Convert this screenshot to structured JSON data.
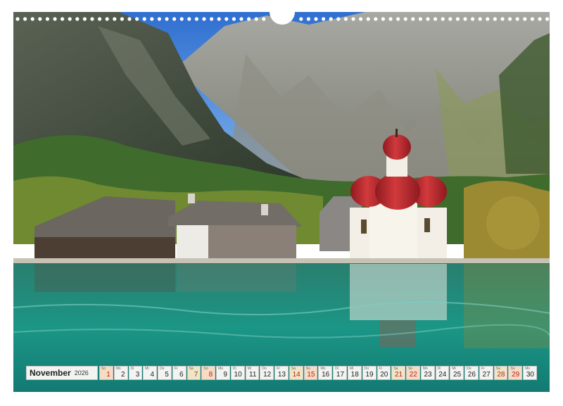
{
  "calendar": {
    "month": "November",
    "year": "2026",
    "days": [
      {
        "num": "1",
        "wd": "So",
        "type": "sun"
      },
      {
        "num": "2",
        "wd": "Mo",
        "type": "wk"
      },
      {
        "num": "3",
        "wd": "Di",
        "type": "wk"
      },
      {
        "num": "4",
        "wd": "Mi",
        "type": "wk"
      },
      {
        "num": "5",
        "wd": "Do",
        "type": "wk"
      },
      {
        "num": "6",
        "wd": "Fr",
        "type": "wk"
      },
      {
        "num": "7",
        "wd": "Sa",
        "type": "sat"
      },
      {
        "num": "8",
        "wd": "So",
        "type": "sun"
      },
      {
        "num": "9",
        "wd": "Mo",
        "type": "wk"
      },
      {
        "num": "10",
        "wd": "Di",
        "type": "wk"
      },
      {
        "num": "11",
        "wd": "Mi",
        "type": "wk"
      },
      {
        "num": "12",
        "wd": "Do",
        "type": "wk"
      },
      {
        "num": "13",
        "wd": "Fr",
        "type": "wk"
      },
      {
        "num": "14",
        "wd": "Sa",
        "type": "sat"
      },
      {
        "num": "15",
        "wd": "So",
        "type": "sun"
      },
      {
        "num": "16",
        "wd": "Mo",
        "type": "wk"
      },
      {
        "num": "17",
        "wd": "Di",
        "type": "wk"
      },
      {
        "num": "18",
        "wd": "Mi",
        "type": "wk"
      },
      {
        "num": "19",
        "wd": "Do",
        "type": "wk"
      },
      {
        "num": "20",
        "wd": "Fr",
        "type": "wk"
      },
      {
        "num": "21",
        "wd": "Sa",
        "type": "sat"
      },
      {
        "num": "22",
        "wd": "So",
        "type": "sun"
      },
      {
        "num": "23",
        "wd": "Mo",
        "type": "wk"
      },
      {
        "num": "24",
        "wd": "Di",
        "type": "wk"
      },
      {
        "num": "25",
        "wd": "Mi",
        "type": "wk"
      },
      {
        "num": "26",
        "wd": "Do",
        "type": "wk"
      },
      {
        "num": "27",
        "wd": "Fr",
        "type": "wk"
      },
      {
        "num": "28",
        "wd": "Sa",
        "type": "sat"
      },
      {
        "num": "29",
        "wd": "So",
        "type": "sun"
      },
      {
        "num": "30",
        "wd": "Mo",
        "type": "wk"
      }
    ]
  },
  "colors": {
    "sky": "#3d7fd6",
    "rock": "#8a8c86",
    "forest": "#3f6b2c",
    "lake": "#1f8a80",
    "dome": "#b8242a",
    "church_wall": "#f3efe6"
  }
}
